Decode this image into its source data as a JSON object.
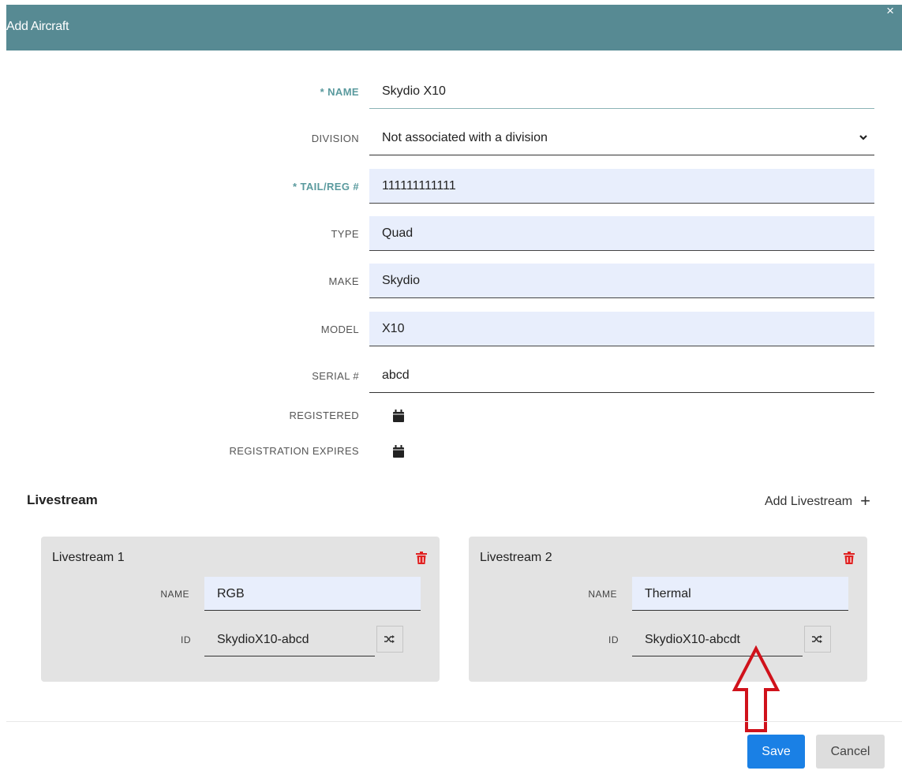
{
  "dialog": {
    "title": "Add Aircraft",
    "close_symbol": "×"
  },
  "form": {
    "name": {
      "label": "* Name",
      "value": "Skydio X10"
    },
    "division": {
      "label": "Division",
      "value": "Not associated with a division"
    },
    "tail": {
      "label": "* Tail/Reg #",
      "value": "111111111111"
    },
    "type": {
      "label": "Type",
      "value": "Quad"
    },
    "make": {
      "label": "Make",
      "value": "Skydio"
    },
    "model": {
      "label": "Model",
      "value": "X10"
    },
    "serial": {
      "label": "Serial #",
      "value": "abcd"
    },
    "registered": {
      "label": "Registered",
      "icon": "calendar-icon"
    },
    "expires": {
      "label": "Registration Expires",
      "icon": "calendar-icon"
    }
  },
  "livestream": {
    "title": "Livestream",
    "add_label": "Add Livestream",
    "add_symbol": "+",
    "items": [
      {
        "title": "Livestream 1",
        "name_label": "Name",
        "name_value": "RGB",
        "id_label": "ID",
        "id_value": "SkydioX10-abcd"
      },
      {
        "title": "Livestream 2",
        "name_label": "Name",
        "name_value": "Thermal",
        "id_label": "ID",
        "id_value": "SkydioX10-abcdt"
      }
    ]
  },
  "footer": {
    "save_label": "Save",
    "cancel_label": "Cancel"
  },
  "colors": {
    "header": "#578a93",
    "required_label": "#5a9a9e",
    "save": "#1a80e5",
    "trash": "#e02020",
    "annotation_arrow": "#d0121b"
  }
}
